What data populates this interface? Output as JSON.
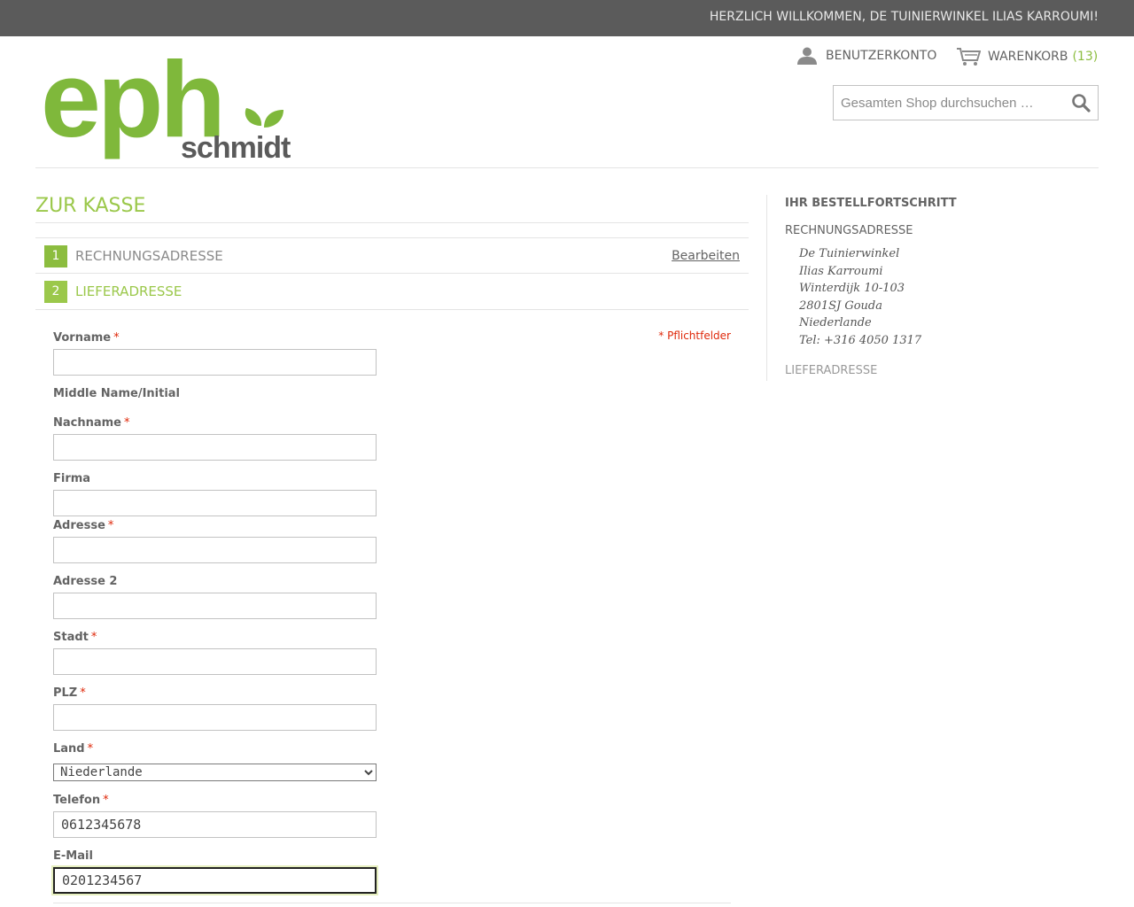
{
  "header": {
    "welcome": "HERZLICH WILLKOMMEN, DE TUINIERWINKEL ILIAS KARROUMI!",
    "account_label": "BENUTZERKONTO",
    "cart_label": "WARENKORB",
    "cart_count": "(13)",
    "search_placeholder": "Gesamten Shop durchsuchen …"
  },
  "logo": {
    "text_main": "eph",
    "text_sub": "schmidt",
    "colors": {
      "green_dark": "#7fb83b",
      "green_light": "#c4dd7b",
      "gray": "#5a5a5a"
    }
  },
  "page": {
    "title": "ZUR KASSE"
  },
  "steps": [
    {
      "number": "1",
      "title": "RECHNUNGSADRESSE",
      "edit_label": "Bearbeiten"
    },
    {
      "number": "2",
      "title": "LIEFERADRESSE"
    }
  ],
  "form": {
    "required_note": "* Pflichtfelder",
    "required_marker": "*",
    "fields": {
      "firstname": {
        "label": "Vorname",
        "value": ""
      },
      "middlename": {
        "label": "Middle Name/Initial"
      },
      "lastname": {
        "label": "Nachname",
        "value": ""
      },
      "company": {
        "label": "Firma",
        "value": ""
      },
      "street1": {
        "label": "Adresse",
        "value": ""
      },
      "street2": {
        "label": "Adresse 2",
        "value": ""
      },
      "city": {
        "label": "Stadt",
        "value": ""
      },
      "postcode": {
        "label": "PLZ",
        "value": ""
      },
      "country": {
        "label": "Land",
        "selected": "Niederlande"
      },
      "telephone": {
        "label": "Telefon",
        "value": "0612345678"
      },
      "email": {
        "label": "E-Mail",
        "value": "0201234567"
      }
    }
  },
  "sidebar": {
    "title": "IHR BESTELLFORTSCHRITT",
    "billing_label": "RECHNUNGSADRESSE",
    "billing_address": [
      "De Tuinierwinkel",
      "Ilias Karroumi",
      "Winterdijk 10-103",
      "2801SJ Gouda",
      "Niederlande",
      "Tel: +316 4050 1317"
    ],
    "shipping_label": "LIEFERADRESSE"
  },
  "colors": {
    "accent_green": "#9bc84b",
    "step_green": "#8cbd3f",
    "required_red": "#df280a",
    "topbar_bg": "#5b5b5b"
  }
}
